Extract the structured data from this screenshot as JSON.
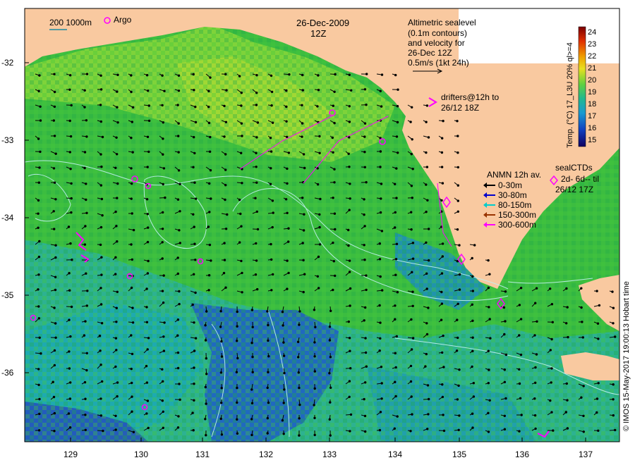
{
  "header": {
    "date": "26-Dec-2009",
    "time": "12Z",
    "scale_label": "200  1000m",
    "argo_label": "Argo"
  },
  "altimetry_note": [
    "Altimetric sealevel",
    "(0.1m contours)",
    "and velocity for",
    "26-Dec 12Z",
    "0.5m/s (1kt 24h)"
  ],
  "drifters_note": [
    "drifters@12h to",
    "26/12 18Z"
  ],
  "anmn_legend": {
    "title": "ANMN 12h av.",
    "items": [
      {
        "label": "0-30m",
        "color": "#000000"
      },
      {
        "label": "30-80m",
        "color": "#0000cc"
      },
      {
        "label": "80-150m",
        "color": "#00cccc"
      },
      {
        "label": "150-300m",
        "color": "#993300"
      },
      {
        "label": "300-600m",
        "color": "#ff00ff"
      }
    ]
  },
  "sealctd_note": [
    "sealCTDs",
    "2d- 6d-- til",
    "26/12 17Z"
  ],
  "colorbar": {
    "title": "Temp. (°C) 17_L3U 20% ql>=4",
    "ticks": [
      "24",
      "23",
      "22",
      "21",
      "20",
      "19",
      "18",
      "17",
      "16",
      "15"
    ]
  },
  "axes": {
    "lat_ticks": [
      "-32",
      "-33",
      "-34",
      "-35",
      "-36"
    ],
    "lon_ticks": [
      "129",
      "130",
      "131",
      "132",
      "133",
      "134",
      "135",
      "136",
      "137"
    ]
  },
  "credit": "© IMOS 15-May-2017 19:00:13 Hobart time",
  "colors": {
    "land": "#f9c9a0",
    "warm": "#d8e030",
    "mid": "#30c040",
    "cool": "#1a9aa8",
    "cold": "#2050c0",
    "magenta": "#ff00ff"
  }
}
